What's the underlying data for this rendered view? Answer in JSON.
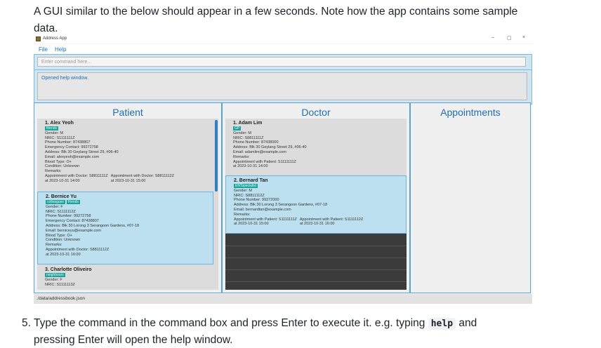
{
  "doc": {
    "intro_line1": "A GUI similar to the below should appear in a few seconds. Note how the app contains some sample",
    "intro_line2": "data.",
    "step5_prefix": "5. Type the command in the command box and press Enter to execute it. e.g. typing",
    "step5_code": "help",
    "step5_suffix": "and",
    "step5_cont": "pressing Enter will open the help window."
  },
  "window": {
    "title": "Address App",
    "controls": [
      "–",
      "▢",
      "×"
    ],
    "icon": "address-book-icon"
  },
  "menu": {
    "items": [
      "File",
      "Help"
    ]
  },
  "command": {
    "placeholder": "Enter command here..."
  },
  "result": {
    "text": "Opened help window."
  },
  "columns": {
    "patient": "Patient",
    "doctor": "Doctor",
    "appointments": "Appointments"
  },
  "patients": [
    {
      "name": "1. Alex Yeoh",
      "tags": [
        "friends"
      ],
      "lines": [
        "Gender: M",
        "NRIC: S1111111Z",
        "Phone Number: 87438807",
        "Emergency Contact: 99272758",
        "Address: Blk 30 Geylang Street 29, #06-40",
        "Email: alexyeoh@example.com",
        "Blood Type: O+",
        "Condition: Unknown",
        "Remarks:"
      ],
      "appts": [
        {
          "a": "Appointment with Doctor: S8811111Z",
          "b": "at 2023-10-31 14:00"
        },
        {
          "a": "Appointment with Doctor: S8811112Z",
          "b": "at 2023-10-31 15:00"
        }
      ]
    },
    {
      "name": "2. Bernice Yu",
      "tags": [
        "colleagues",
        "friends"
      ],
      "lines": [
        "Gender: F",
        "NRIC: S1111112Z",
        "Phone Number: 99272758",
        "Emergency Contact: 87438807",
        "Address: Blk 30 Lorong 3 Serangoon Gardens, #07-18",
        "Email: berniceyu@example.com",
        "Blood Type: O+",
        "Condition: Unknown",
        "Remarks:",
        "Appointment with Doctor: S8811112Z",
        "at 2023-10-31 16:00"
      ]
    },
    {
      "name": "3. Charlotte Oliveiro",
      "tags": [
        "neighbours"
      ],
      "lines": [
        "Gender: F",
        "NRIC: S1111113Z"
      ]
    }
  ],
  "doctors": [
    {
      "name": "1. Adam Lim",
      "tags": [
        "GP"
      ],
      "lines": [
        "Gender: M",
        "NRIC: S8811111Z",
        "Phone Number: 87438000",
        "Address: Blk 30 Geylang Street 29, #06-40",
        "Email: adamlim@example.com",
        "Remarks:",
        "Appointment with Patient: S1111111Z",
        "at 2023-10-31 14:00"
      ]
    },
    {
      "name": "2. Bernard Tan",
      "tags": [
        "ENTspecialist"
      ],
      "lines": [
        "Gender: M",
        "NRIC: S8811112Z",
        "Phone Number: 99272000",
        "Address: Blk 30 Lorong 3 Serangoon Gardens, #07-18",
        "Email: bernardtan@example.com",
        "Remarks:"
      ],
      "appts": [
        {
          "a": "Appointment with Patient: S1111111Z",
          "b": "at 2023-10-31 15:00"
        },
        {
          "a": "Appointment with Patient: S1111112Z",
          "b": "at 2023-10-31 16:00"
        }
      ]
    }
  ],
  "status": {
    "path": "./data/addressbook.json"
  }
}
